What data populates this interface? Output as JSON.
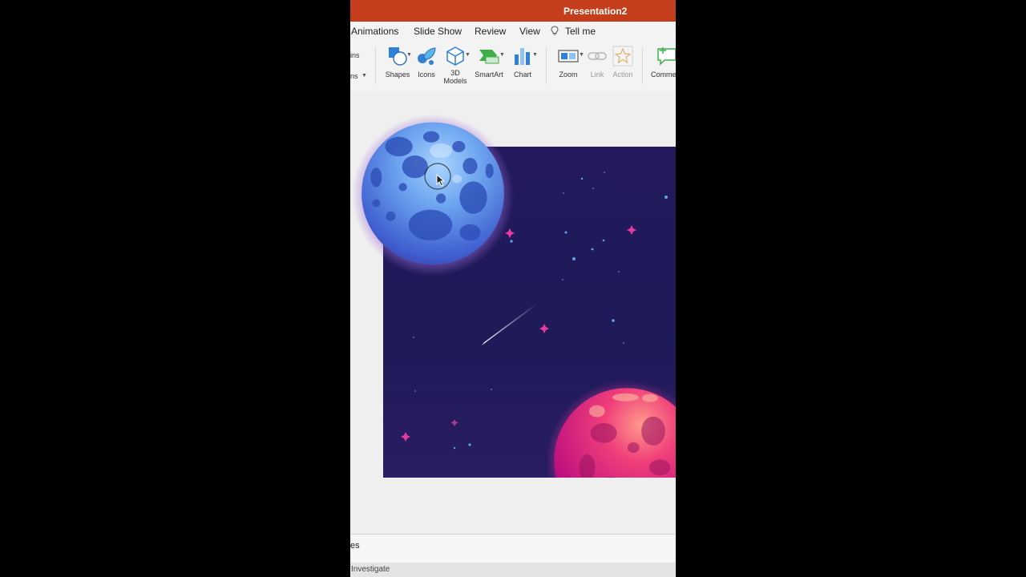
{
  "window": {
    "title": "Presentation2"
  },
  "tabs": {
    "animations": "Animations",
    "slide_show": "Slide Show",
    "review": "Review",
    "view": "View",
    "tell_me": "Tell me"
  },
  "ribbon": {
    "cut_left_top": "ins",
    "cut_left_bottom": "ns",
    "shapes": "Shapes",
    "icons": "Icons",
    "models_line1": "3D",
    "models_line2": "Models",
    "smartart": "SmartArt",
    "chart": "Chart",
    "zoom": "Zoom",
    "link": "Link",
    "action": "Action",
    "comment": "Comme"
  },
  "notes": {
    "label": "es"
  },
  "status": {
    "text": "Investigate"
  },
  "icons": {
    "shapes": "shapes-icon",
    "icons": "icons-icon",
    "models": "cube-icon",
    "smartart": "smartart-icon",
    "chart": "bar-chart-icon",
    "zoom": "zoom-icon",
    "link": "link-icon",
    "action": "star-icon",
    "comment": "comment-icon",
    "tell_me": "lightbulb-icon"
  },
  "colors": {
    "title_bar": "#c43e1c",
    "slide_background": "#221a5c",
    "ribbon_accent": "#2f80d6",
    "planet_blue": "#4a7be0",
    "planet_pink": "#e0208a"
  }
}
